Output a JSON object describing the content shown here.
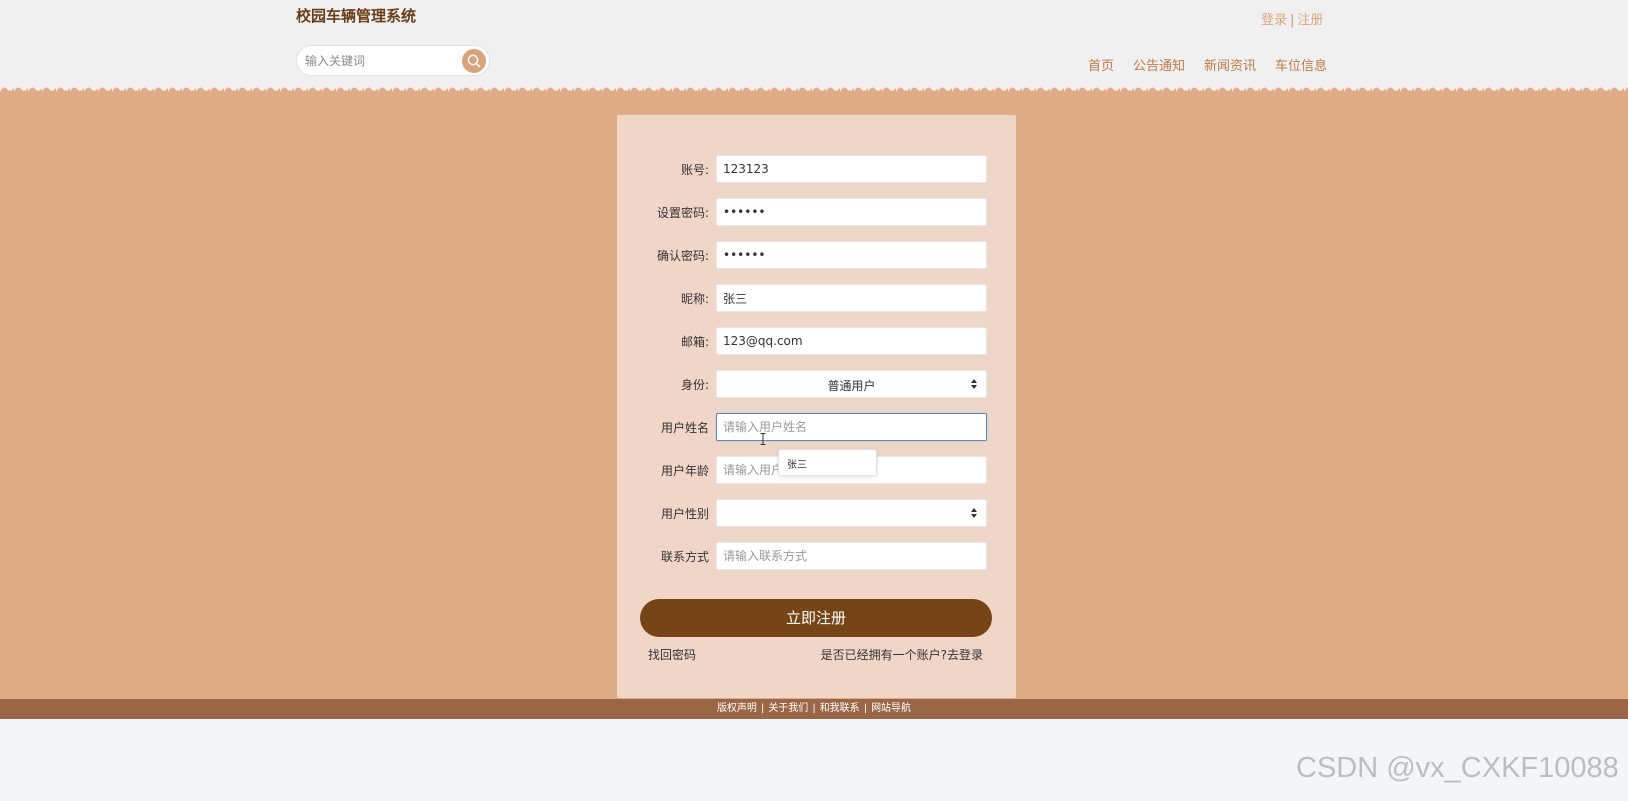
{
  "header": {
    "title": "校园车辆管理系统",
    "login_link": "登录",
    "link_separator": "|",
    "register_link": "注册",
    "search": {
      "placeholder": "输入关键词",
      "value": ""
    },
    "nav": [
      "首页",
      "公告通知",
      "新闻资讯",
      "车位信息"
    ]
  },
  "form": {
    "account": {
      "label": "账号:",
      "value": "123123"
    },
    "password": {
      "label": "设置密码:",
      "value": "••••••"
    },
    "confirm_password": {
      "label": "确认密码:",
      "value": "••••••"
    },
    "nickname": {
      "label": "昵称:",
      "value": "张三"
    },
    "email": {
      "label": "邮箱:",
      "value": "123@qq.com"
    },
    "identity": {
      "label": "身份:",
      "value": "普通用户"
    },
    "user_name": {
      "label": "用户姓名",
      "placeholder": "请输入用户姓名",
      "value": ""
    },
    "user_age": {
      "label": "用户年龄",
      "placeholder": "请输入用户年龄",
      "value": ""
    },
    "user_gender": {
      "label": "用户性别",
      "value": ""
    },
    "contact": {
      "label": "联系方式",
      "placeholder": "请输入联系方式",
      "value": ""
    },
    "autocomplete_suggestion": "张三",
    "submit_label": "立即注册",
    "forgot_password": "找回密码",
    "login_prompt": "是否已经拥有一个账户?",
    "login_link": "去登录"
  },
  "footer": {
    "links": [
      "版权声明",
      "关于我们",
      "和我联系",
      "网站导航"
    ],
    "separator": "|"
  },
  "watermark": "CSDN @vx_CXKF10088",
  "colors": {
    "header_bg": "#f0f0f0",
    "brand": "#6b3d15",
    "nav": "#c27a45",
    "main_bg": "#dfac86",
    "card_bg": "#f0d6c6",
    "submit_bg": "#774515",
    "footer_bg": "#9b6646"
  },
  "icons": {
    "search_button": "magnifier-icon",
    "select_arrows": "sort-arrows-icon",
    "text_cursor": "ibeam-cursor-icon"
  }
}
